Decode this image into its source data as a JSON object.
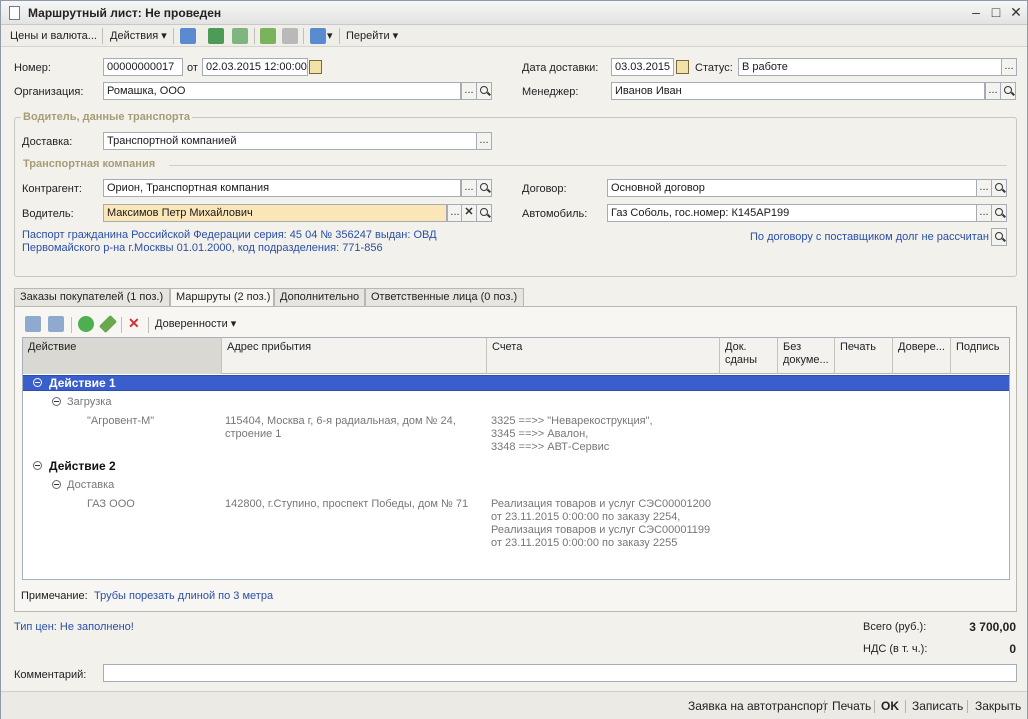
{
  "window": {
    "title": "Маршрутный лист: Не проведен",
    "controls": [
      "–",
      "□",
      "✕"
    ]
  },
  "toolbar": {
    "prices": "Цены и валюта...",
    "actions": "Действия",
    "goto": "Перейти"
  },
  "header": {
    "number_label": "Номер:",
    "number_value": "00000000017",
    "from_label": "от",
    "date_value": "02.03.2015 12:00:00",
    "org_label": "Организация:",
    "org_value": "Ромашка, ООО",
    "delivery_date_label": "Дата доставки:",
    "delivery_date_value": "03.03.2015",
    "status_label": "Статус:",
    "status_value": "В работе",
    "manager_label": "Менеджер:",
    "manager_value": "Иванов Иван"
  },
  "driver_group": {
    "title": "Водитель, данные транспорта",
    "delivery_label": "Доставка:",
    "delivery_value": "Транспортной компанией",
    "tc_title": "Транспортная компания",
    "counterparty_label": "Контрагент:",
    "counterparty_value": "Орион, Транспортная компания",
    "driver_label": "Водитель:",
    "driver_value": "Максимов Петр Михайлович",
    "contract_label": "Договор:",
    "contract_value": "Основной договор",
    "car_label": "Автомобиль:",
    "car_value": "Газ Соболь, гос.номер: К145АР199",
    "passport_line1": "Паспорт гражданина Российской Федерации серия: 45 04 № 356247 выдан: ОВД",
    "passport_line2": "Первомайского р-на г.Москвы 01.01.2000, код подразделения: 771-856",
    "debt_link": "По договору с поставщиком долг не рассчитан"
  },
  "tabs": [
    {
      "label": "Заказы покупателей (1 поз.)"
    },
    {
      "label": "Маршруты (2 поз.)"
    },
    {
      "label": "Дополнительно"
    },
    {
      "label": "Ответственные лица (0 поз.)"
    }
  ],
  "routes_toolbar": {
    "powers_label": "Доверенности"
  },
  "grid": {
    "columns": [
      "Действие",
      "Адрес прибытия",
      "Счета",
      "Док. сданы",
      "Без докуме...",
      "Печать",
      "Довере...",
      "Подпись"
    ],
    "groups": [
      {
        "title": "Действие 1",
        "subtitle": "Загрузка",
        "name": "\"Агровент-М\"",
        "address": [
          "115404, Москва г, 6-я радиальная, дом № 24,",
          "строение 1"
        ],
        "invoices": [
          "3325 ==>> \"Неварекострукция\",",
          "3345 ==>> Авалон,",
          "3348 ==>> АВТ-Сервис"
        ]
      },
      {
        "title": "Действие 2",
        "subtitle": "Доставка",
        "name": "ГАЗ ООО",
        "address": [
          "142800, г.Ступино, проспект Победы, дом № 71"
        ],
        "invoices": [
          "Реализация товаров и услуг СЭС00001200",
          "от 23.11.2015 0:00:00 по заказу 2254,",
          "Реализация товаров и услуг СЭС00001199",
          "от 23.11.2015 0:00:00 по заказу 2255"
        ]
      }
    ]
  },
  "note": {
    "label": "Примечание:",
    "value": "Трубы порезать длиной по 3 метра"
  },
  "footer": {
    "price_type_link": "Тип цен: Не заполнено!",
    "total_label": "Всего (руб.):",
    "total_value": "3 700,00",
    "vat_label": "НДС (в т. ч.):",
    "vat_value": "0",
    "comment_label": "Комментарий:"
  },
  "statusbar": {
    "request": "Заявка на автотранспорт",
    "print": "Печать",
    "ok": "OK",
    "save": "Записать",
    "close": "Закрыть"
  }
}
